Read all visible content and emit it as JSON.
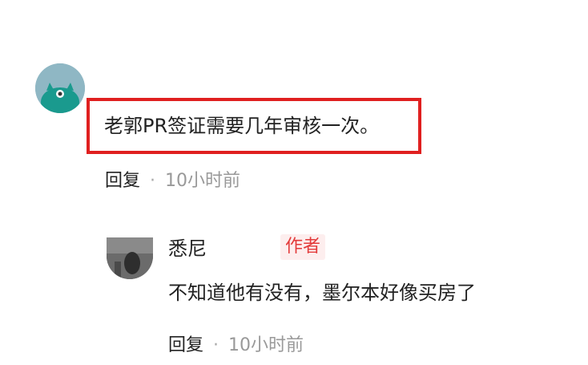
{
  "comment": {
    "text": "老郭PR签证需要几年审核一次。",
    "reply_label": "回复",
    "separator": "·",
    "time": "10小时前"
  },
  "reply": {
    "author_name": "悉尼",
    "author_badge": "作者",
    "text": "不知道他有没有，墨尔本好像买房了",
    "reply_label": "回复",
    "separator": "·",
    "time": "10小时前"
  },
  "colors": {
    "highlight_border": "#e02020",
    "badge_text": "#e33b3b",
    "badge_bg": "#fdeeee",
    "avatar_bg": "#8fb7c4",
    "avatar_mascot": "#1a9a8e"
  },
  "icons": {
    "main_avatar": "teal-mascot-avatar",
    "reply_avatar": "photo-avatar"
  }
}
